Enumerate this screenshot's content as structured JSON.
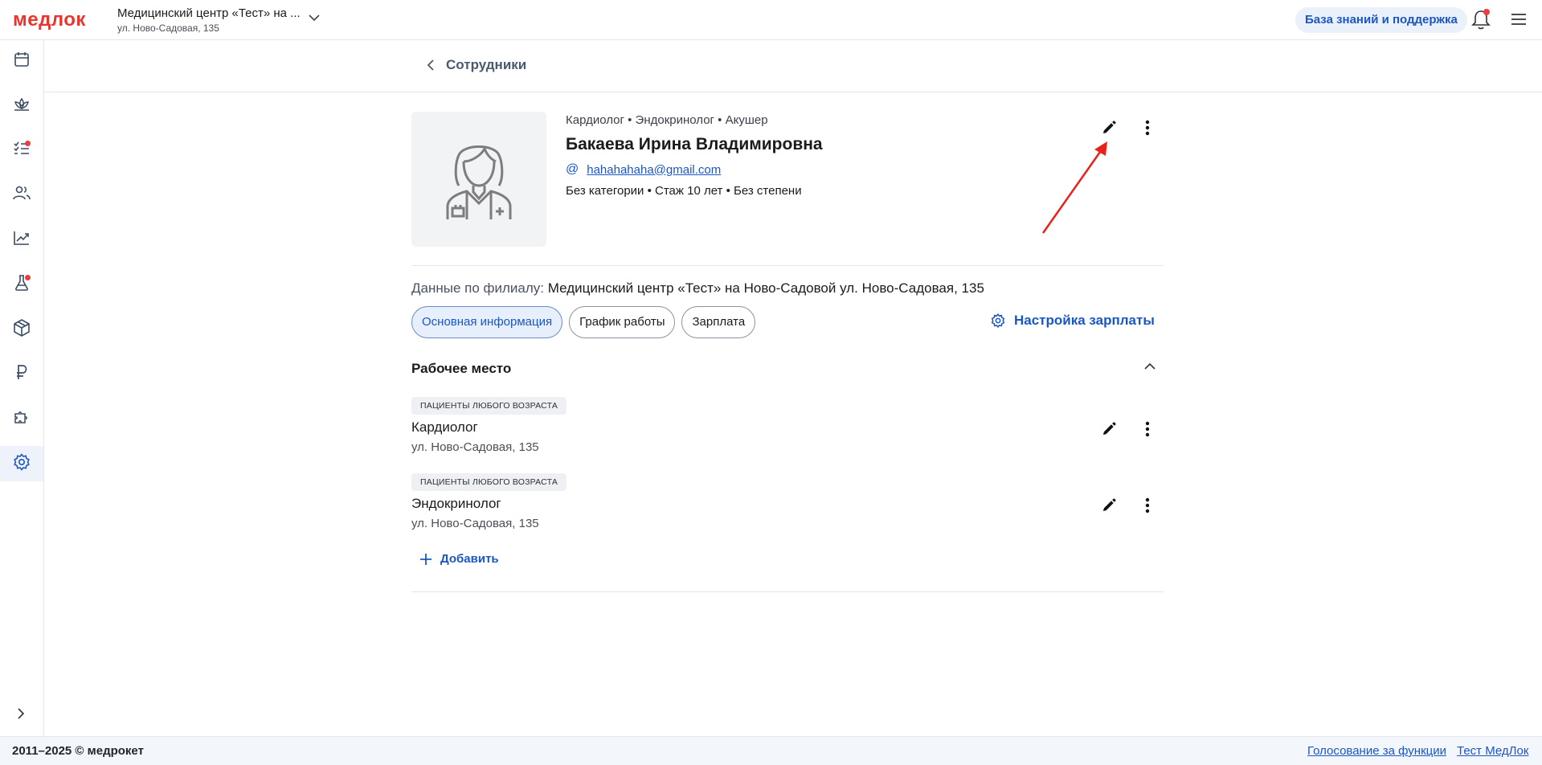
{
  "header": {
    "logo": "медлок",
    "clinic_name": "Медицинский центр «Тест» на ...",
    "clinic_address": "ул. Ново-Садовая, 135",
    "kb_button": "База знаний и поддержка"
  },
  "sidebar": {
    "items": [
      {
        "icon": "calendar-icon"
      },
      {
        "icon": "lotus-icon"
      },
      {
        "icon": "checklist-icon",
        "badge": true
      },
      {
        "icon": "users-icon"
      },
      {
        "icon": "chart-icon"
      },
      {
        "icon": "flask-icon",
        "badge": true
      },
      {
        "icon": "box-icon"
      },
      {
        "icon": "ruble-icon"
      },
      {
        "icon": "puzzle-icon"
      },
      {
        "icon": "gear-icon",
        "active": true
      }
    ]
  },
  "breadcrumb": {
    "back_label": "Сотрудники"
  },
  "profile": {
    "specialties": "Кардиолог • Эндокринолог • Акушер",
    "full_name": "Бакаева Ирина Владимировна",
    "email_icon": "@",
    "email": "hahahahaha@gmail.com",
    "meta": "Без категории • Стаж 10 лет • Без степени"
  },
  "branch": {
    "label": "Данные по филиалу:",
    "value": "Медицинский центр «Тест» на Ново-Садовой ул. Ново-Садовая, 135"
  },
  "tabs": [
    "Основная информация",
    "График работы",
    "Зарплата"
  ],
  "active_tab": "Основная информация",
  "salary_settings": "Настройка зарплаты",
  "workplace_section": {
    "title": "Рабочее место",
    "items": [
      {
        "badge": "Пациенты любого возраста",
        "title": "Кардиолог",
        "address": "ул. Ново-Садовая, 135"
      },
      {
        "badge": "Пациенты любого возраста",
        "title": "Эндокринолог",
        "address": "ул. Ново-Садовая, 135"
      }
    ],
    "add_label": "Добавить"
  },
  "footer": {
    "copyright": "2011–2025 © медрокет",
    "link_vote": "Голосование за функции",
    "link_test": "Тест МедЛок"
  },
  "colors": {
    "accent": "#1a56c4",
    "brand": "#e8362e",
    "annotation_arrow": "#e8221b"
  }
}
